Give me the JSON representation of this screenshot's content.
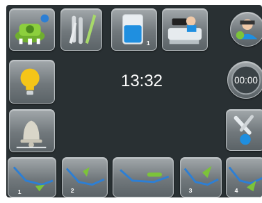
{
  "time": "13:32",
  "timer_label": "00:00",
  "icons": {
    "top": [
      "dosing-unit-icon",
      "test-tubes-icon",
      "water-tank-icon",
      "dental-chair-icon",
      "user-profile-icon"
    ],
    "left": [
      "lamp-icon",
      "bell-icon"
    ],
    "right": [
      "timer-icon",
      "service-tools-icon"
    ],
    "bottom": [
      "chair-program-1-icon",
      "chair-program-2-icon",
      "chair-program-3-icon",
      "chair-program-4-icon",
      "chair-program-5-icon"
    ]
  },
  "program_numbers": [
    "1",
    "2",
    "3",
    "4"
  ],
  "tank_number": "1",
  "colors": {
    "background": "#293033",
    "accent_green": "#7cc33a",
    "accent_blue": "#2d7fd4",
    "lamp_yellow": "#f5c518"
  }
}
